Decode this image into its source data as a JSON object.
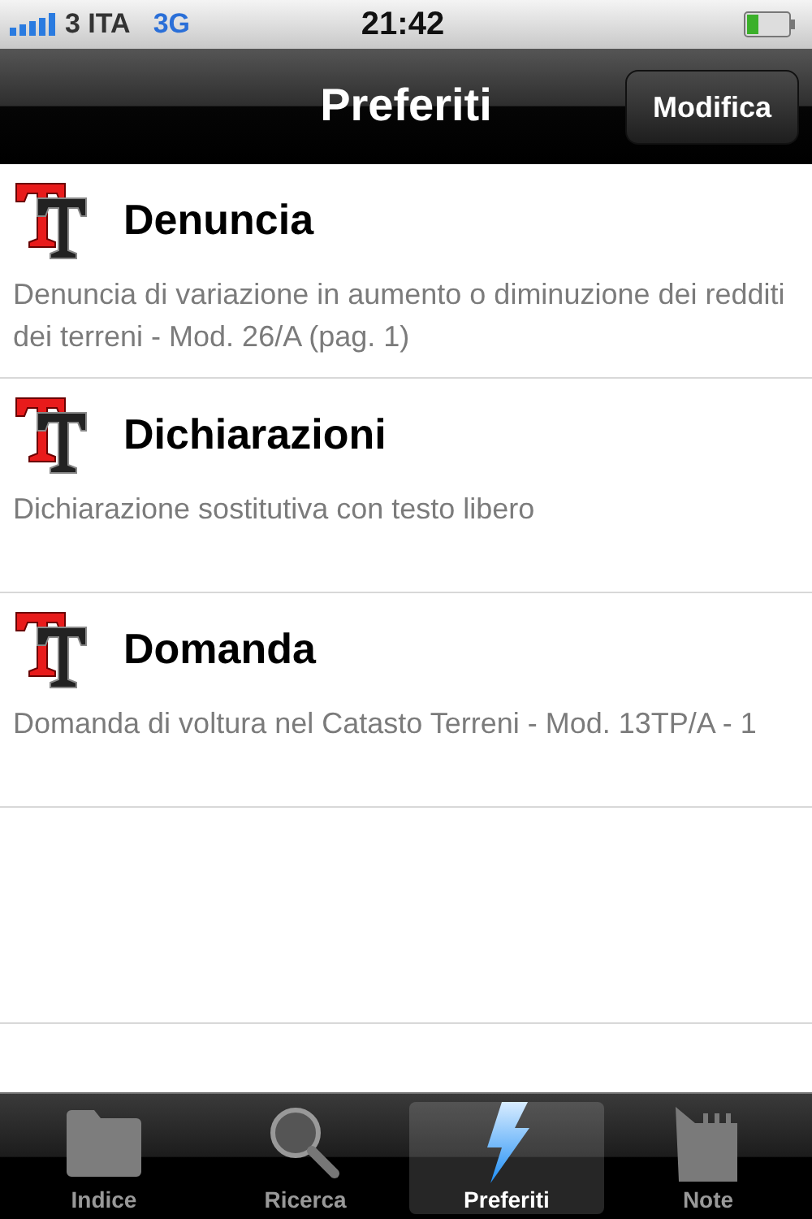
{
  "status_bar": {
    "carrier": "3 ITA",
    "network": "3G",
    "time": "21:42"
  },
  "nav_bar": {
    "title": "Preferiti",
    "button": "Modifica"
  },
  "items": [
    {
      "title": "Denuncia",
      "subtitle": "Denuncia di variazione in aumento o diminuzione dei redditi dei terreni - Mod. 26/A (pag. 1)"
    },
    {
      "title": "Dichiarazioni",
      "subtitle": "Dichiarazione sostitutiva con testo libero"
    },
    {
      "title": "Domanda",
      "subtitle": "Domanda di voltura nel Catasto Terreni - Mod. 13TP/A - 1"
    }
  ],
  "tabs": [
    {
      "label": "Indice",
      "kind": "folder",
      "selected": false
    },
    {
      "label": "Ricerca",
      "kind": "search",
      "selected": false
    },
    {
      "label": "Preferiti",
      "kind": "bolt",
      "selected": true
    },
    {
      "label": "Note",
      "kind": "notepad",
      "selected": false
    }
  ]
}
